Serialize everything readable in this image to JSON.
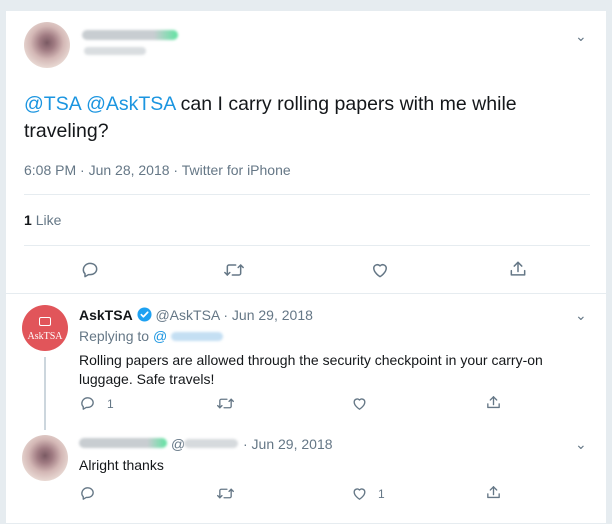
{
  "main_tweet": {
    "mentions": [
      "@TSA",
      "@AskTSA"
    ],
    "text": "can I carry rolling papers with me while traveling?",
    "meta": "6:08 PM · Jun 28, 2018 · Twitter for iPhone",
    "likes_count": "1",
    "likes_label": "Like"
  },
  "reply1": {
    "name": "AskTSA",
    "handle": "@AskTSA",
    "date": "· Jun 29, 2018",
    "replying_to": "Replying to",
    "replying_handle": "@",
    "avatar_text": "AskTSA",
    "body": "Rolling papers are allowed through the security checkpoint in your carry-on luggage. Safe travels!",
    "reply_count": "1"
  },
  "reply2": {
    "handle_prefix": "@",
    "date": "· Jun 29, 2018",
    "body": "Alright thanks",
    "like_count": "1"
  },
  "colors": {
    "link": "#1b95e0",
    "muted": "#657786",
    "asktsa_avatar": "#e1555a",
    "verified": "#1da1f2",
    "blur_green": "#5fe3a1"
  },
  "icons": [
    "reply-icon",
    "retweet-icon",
    "like-icon",
    "share-icon",
    "chevron-down-icon",
    "verified-badge-icon"
  ]
}
